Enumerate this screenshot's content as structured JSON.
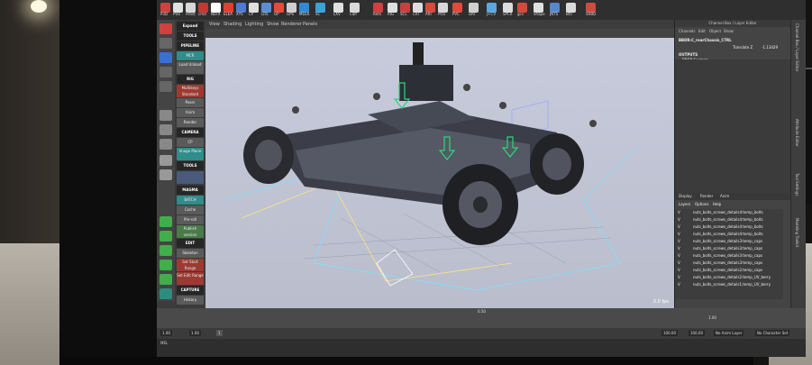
{
  "shelf": {
    "icons": [
      "P3D",
      "PVis",
      "Artist",
      "cmd",
      "NoFX",
      "ELEA",
      "XYS",
      "CP",
      "LRS",
      "GP",
      "GPS",
      "MDLR",
      "SC",
      "LXV",
      "Calf",
      "Retn",
      "RIG",
      "SCL",
      "CRI",
      "ARI",
      "POS",
      "PVC",
      "DAT",
      "J+CV",
      "SPCX",
      "gcs",
      "Shape",
      "JNTS",
      "Btn",
      "SRBD"
    ]
  },
  "left_tools": {
    "expand": "Expand"
  },
  "toolbox": {
    "buttons": [
      "Expand",
      "TOOLS",
      "PIPELINE",
      "MCR",
      "Load Unload",
      "RIG",
      "Multikeys Standard",
      "Poser",
      "Anim",
      "Render",
      "CAMERA",
      "CP",
      "Image Plane",
      "TOOLS",
      "MAGMA",
      "BATCH",
      "Cache",
      "Pre-roll",
      "Publish version",
      "EDIT",
      "Skeleton",
      "Set Start Range",
      "Set Edit Range",
      "CAPTURE",
      "History",
      "HR Capture"
    ]
  },
  "viewport": {
    "menu": [
      "View",
      "Shading",
      "Lighting",
      "Show",
      "Renderer",
      "Panels"
    ],
    "fps": "0.0 fps"
  },
  "channel_box": {
    "title": "Channel Box / Layer Editor",
    "tabs": [
      "Channels",
      "Edit",
      "Object",
      "Show"
    ],
    "selected": "BBDR:C_rearChassis_CTRL",
    "attr_label": "Translate Z",
    "attr_value": "-1.13429",
    "outputs_label": "OUTPUTS",
    "output_item": "BBDR:Controls"
  },
  "layers": {
    "tabs": [
      "Display",
      "Render",
      "Anim"
    ],
    "menu": [
      "Layers",
      "Options",
      "Help"
    ],
    "rows": [
      {
        "v": "V",
        "name": "nuts_bolts_screws_details4:temp_bolts"
      },
      {
        "v": "V",
        "name": "nuts_bolts_screws_details4:temp_bolts"
      },
      {
        "v": "V",
        "name": "nuts_bolts_screws_details4:temp_bolts"
      },
      {
        "v": "V",
        "name": "nuts_bolts_screws_details4:temp_bolts"
      },
      {
        "v": "V",
        "name": "nuts_bolts_screws_details3:temp_caps"
      },
      {
        "v": "V",
        "name": "nuts_bolts_screws_details3:temp_caps"
      },
      {
        "v": "V",
        "name": "nuts_bolts_screws_details3:temp_caps"
      },
      {
        "v": "V",
        "name": "nuts_bolts_screws_details3:temp_caps"
      },
      {
        "v": "V",
        "name": "nuts_bolts_screws_details2:temp_caps"
      },
      {
        "v": "V",
        "name": "nuts_bolts_screws_details2:temp_UV_berry"
      },
      {
        "v": "V",
        "name": "nuts_bolts_screws_details1:temp_UV_berry"
      }
    ]
  },
  "right_vtabs": [
    "Channel Box / Layer Editor",
    "Attribute Editor",
    "Tool Settings",
    "Modeling Toolkit"
  ],
  "timeline": {
    "current": "0.50",
    "frame": "1.00",
    "range_start": "1.00",
    "range_start2": "1.00",
    "range_end": "100.00",
    "range_end2": "100.00",
    "range_mid": "1",
    "anim_layer": "No Anim Layer",
    "char_set": "No Character Set"
  },
  "command_line": {
    "label": "MEL"
  }
}
